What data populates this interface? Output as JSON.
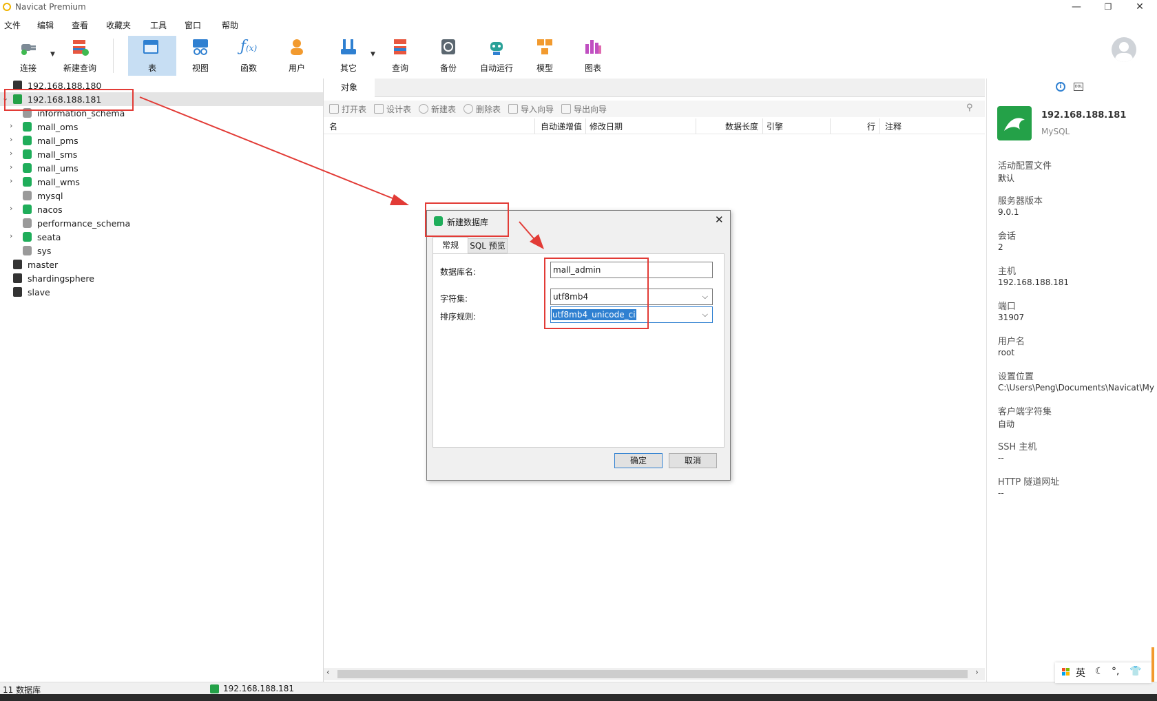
{
  "app": {
    "title": "Navicat Premium"
  },
  "menu": [
    "文件",
    "编辑",
    "查看",
    "收藏夹",
    "工具",
    "窗口",
    "帮助"
  ],
  "toolbar": [
    {
      "label": "连接",
      "icon": "plug-icon",
      "color": "#4a90d9"
    },
    {
      "label": "新建查询",
      "icon": "new-query-icon",
      "color": "#e8573f"
    },
    {
      "label": "表",
      "icon": "table-icon",
      "color": "#2f80d1",
      "active": true
    },
    {
      "label": "视图",
      "icon": "view-icon",
      "color": "#2f80d1"
    },
    {
      "label": "函数",
      "icon": "function-icon",
      "color": "#2f80d1"
    },
    {
      "label": "用户",
      "icon": "user-icon",
      "color": "#f29a2e"
    },
    {
      "label": "其它",
      "icon": "tools-icon",
      "color": "#2f80d1"
    },
    {
      "label": "查询",
      "icon": "query-icon",
      "color": "#e8573f"
    },
    {
      "label": "备份",
      "icon": "backup-icon",
      "color": "#5b6770"
    },
    {
      "label": "自动运行",
      "icon": "robot-icon",
      "color": "#2aa198"
    },
    {
      "label": "模型",
      "icon": "model-icon",
      "color": "#f29a2e"
    },
    {
      "label": "图表",
      "icon": "chart-icon",
      "color": "#c04fc1"
    }
  ],
  "tree": {
    "connections_top": [
      {
        "label": "192.168.188.180"
      },
      {
        "label": "192.168.188.181",
        "expanded": true
      }
    ],
    "databases": [
      {
        "label": "information_schema",
        "type": "gray",
        "expandable": false
      },
      {
        "label": "mall_oms",
        "type": "green",
        "expandable": true
      },
      {
        "label": "mall_pms",
        "type": "green",
        "expandable": true
      },
      {
        "label": "mall_sms",
        "type": "green",
        "expandable": true
      },
      {
        "label": "mall_ums",
        "type": "green",
        "expandable": true
      },
      {
        "label": "mall_wms",
        "type": "green",
        "expandable": true
      },
      {
        "label": "mysql",
        "type": "gray",
        "expandable": false
      },
      {
        "label": "nacos",
        "type": "green",
        "expandable": true
      },
      {
        "label": "performance_schema",
        "type": "gray",
        "expandable": false
      },
      {
        "label": "seata",
        "type": "green",
        "expandable": true
      },
      {
        "label": "sys",
        "type": "gray",
        "expandable": false
      }
    ],
    "connections_bottom": [
      {
        "label": "master"
      },
      {
        "label": "shardingsphere"
      },
      {
        "label": "slave"
      }
    ]
  },
  "tabs": {
    "objects": "对象"
  },
  "object_toolbar": [
    "打开表",
    "设计表",
    "新建表",
    "删除表",
    "导入向导",
    "导出向导"
  ],
  "columns": [
    "名",
    "自动递增值",
    "修改日期",
    "数据长度",
    "引擎",
    "行",
    "注释"
  ],
  "info": {
    "name": "192.168.188.181",
    "type": "MySQL",
    "fields": [
      {
        "label": "活动配置文件",
        "value": "默认"
      },
      {
        "label": "服务器版本",
        "value": "9.0.1"
      },
      {
        "label": "会话",
        "value": "2"
      },
      {
        "label": "主机",
        "value": "192.168.188.181"
      },
      {
        "label": "端口",
        "value": "31907"
      },
      {
        "label": "用户名",
        "value": "root"
      },
      {
        "label": "设置位置",
        "value": "C:\\Users\\Peng\\Documents\\Navicat\\My"
      },
      {
        "label": "客户端字符集",
        "value": "自动"
      },
      {
        "label": "SSH 主机",
        "value": "--"
      },
      {
        "label": "HTTP 隧道网址",
        "value": "--"
      }
    ]
  },
  "dialog": {
    "title": "新建数据库",
    "tabs": [
      "常规",
      "SQL 预览"
    ],
    "db_name_label": "数据库名:",
    "db_name_value": "mall_admin",
    "charset_label": "字符集:",
    "charset_value": "utf8mb4",
    "collation_label": "排序规则:",
    "collation_value": "utf8mb4_unicode_ci",
    "ok": "确定",
    "cancel": "取消"
  },
  "status": {
    "db_count": "11 数据库",
    "connection": "192.168.188.181"
  },
  "ime": {
    "lang": "英"
  },
  "colors": {
    "accent": "#2f80d1",
    "selection": "#c7def3",
    "annotation_red": "#e23b36",
    "mysql_green": "#24a148"
  }
}
